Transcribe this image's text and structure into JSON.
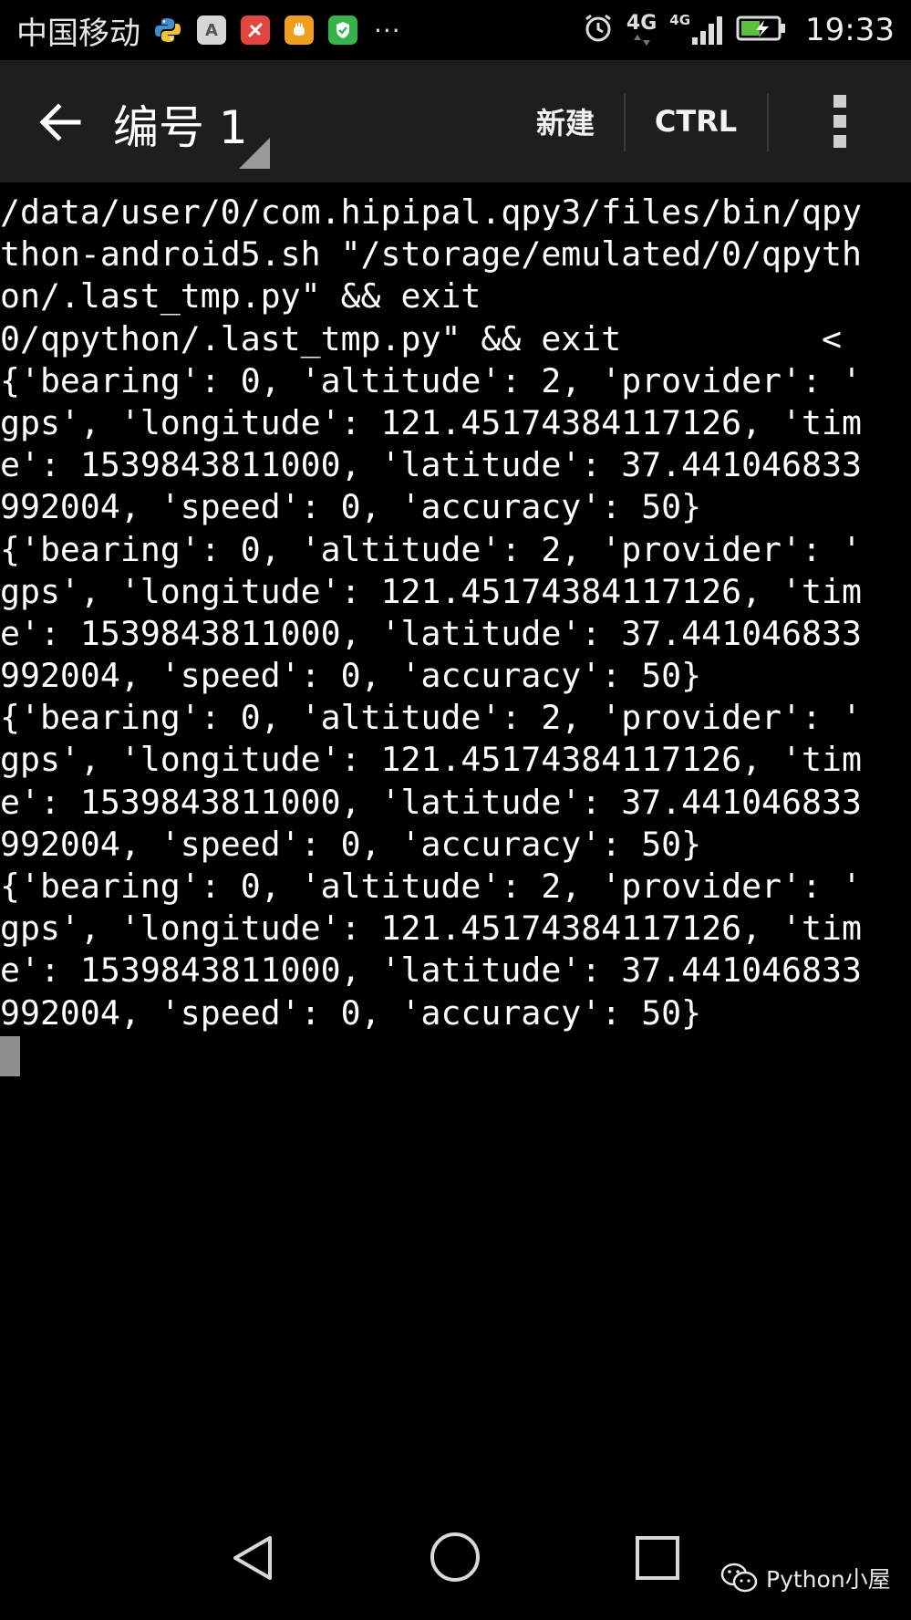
{
  "status_bar": {
    "carrier": "中国移动",
    "notification_icons": [
      "python-icon",
      "font-app-icon",
      "red-app-icon",
      "orange-app-icon",
      "green-shield-icon"
    ],
    "font_icon_letter": "A",
    "more": "···",
    "network_primary": "4G",
    "network_secondary": "4G",
    "time": "19:33"
  },
  "app_bar": {
    "title": "编号 1",
    "new_label": "新建",
    "ctrl_label": "CTRL"
  },
  "terminal": {
    "lines": [
      "/data/user/0/com.hipipal.qpy3/files/bin/qpy",
      "thon-android5.sh \"/storage/emulated/0/qpyth",
      "on/.last_tmp.py\" && exit",
      "0/qpython/.last_tmp.py\" && exit          <",
      "{'bearing': 0, 'altitude': 2, 'provider': '",
      "gps', 'longitude': 121.45174384117126, 'tim",
      "e': 1539843811000, 'latitude': 37.441046833",
      "992004, 'speed': 0, 'accuracy': 50}",
      "{'bearing': 0, 'altitude': 2, 'provider': '",
      "gps', 'longitude': 121.45174384117126, 'tim",
      "e': 1539843811000, 'latitude': 37.441046833",
      "992004, 'speed': 0, 'accuracy': 50}",
      "{'bearing': 0, 'altitude': 2, 'provider': '",
      "gps', 'longitude': 121.45174384117126, 'tim",
      "e': 1539843811000, 'latitude': 37.441046833",
      "992004, 'speed': 0, 'accuracy': 50}",
      "{'bearing': 0, 'altitude': 2, 'provider': '",
      "gps', 'longitude': 121.45174384117126, 'tim",
      "e': 1539843811000, 'latitude': 37.441046833",
      "992004, 'speed': 0, 'accuracy': 50}"
    ]
  },
  "nav_bar": {
    "buttons": [
      "back-triangle-icon",
      "home-circle-icon",
      "recents-square-icon"
    ]
  },
  "watermark": {
    "text": "Python小屋",
    "icon": "wechat-icon"
  },
  "colors": {
    "app_bar_bg": "#1e1e1e",
    "terminal_bg": "#000000",
    "terminal_fg": "#ffffff"
  }
}
